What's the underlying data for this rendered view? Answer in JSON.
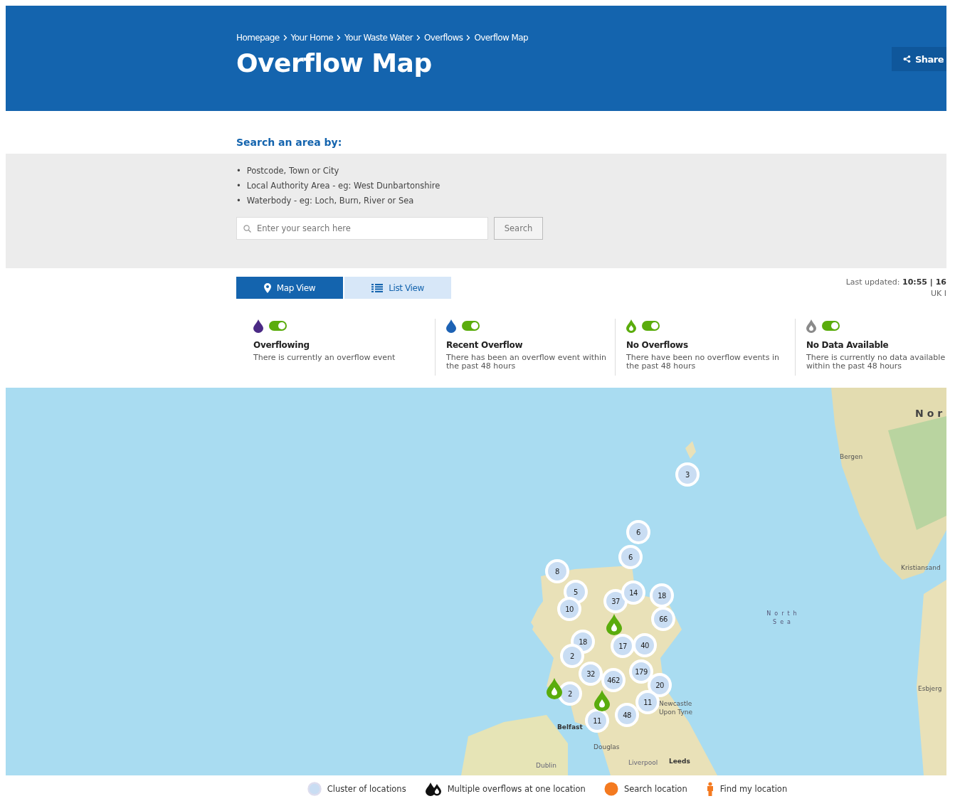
{
  "header": {
    "breadcrumbs": [
      "Homepage",
      "Your Home",
      "Your Waste Water",
      "Overflows",
      "Overflow Map"
    ],
    "title": "Overflow Map",
    "share_button": "Share"
  },
  "search": {
    "heading": "Search an area by:",
    "bullet": "•",
    "options": [
      "Postcode, Town or City",
      "Local Authority Area - eg: West Dunbartonshire",
      "Waterbody - eg: Loch, Burn, River or Sea"
    ],
    "placeholder": "Enter your search here",
    "button": "Search"
  },
  "view_tabs": [
    {
      "label": "Map View",
      "selected": true
    },
    {
      "label": "List View",
      "selected": false
    }
  ],
  "last_updated": {
    "text": "Last updated: **10:55 | 16**",
    "line_2": "UK I"
  },
  "legend": [
    {
      "title": "Overflowing",
      "description": "There is currently an overflow event",
      "color": "#4b2a85",
      "kind": "filled",
      "on": true
    },
    {
      "title": "Recent Overflow",
      "description": "There has been an overflow event within the past 48 hours",
      "color": "#1d62b4",
      "kind": "filled",
      "on": true
    },
    {
      "title": "No Overflows",
      "description": "There have been no overflow events in the past 48 hours",
      "color": "#5aac0c",
      "kind": "outline",
      "on": true
    },
    {
      "title": "No Data Available",
      "description": "There is currently no data available within the past 48 hours",
      "color": "#8a8a8a",
      "kind": "outline",
      "on": true
    }
  ],
  "map": {
    "labels": [
      "Nor",
      "Bergen",
      "Kristiansand",
      "North Sea",
      "Esbjerg",
      "Newcastle Upon Tyne",
      "Belfast",
      "Douglas",
      "Leeds",
      "Dublin",
      "Liverpool"
    ],
    "markers": [
      {
        "kind": "cluster",
        "count": "3"
      },
      {
        "kind": "cluster",
        "count": "6"
      },
      {
        "kind": "cluster",
        "count": "6"
      },
      {
        "kind": "cluster",
        "count": "8"
      },
      {
        "kind": "cluster",
        "count": "5"
      },
      {
        "kind": "cluster",
        "count": "10"
      },
      {
        "kind": "cluster",
        "count": "37"
      },
      {
        "kind": "cluster",
        "count": "14"
      },
      {
        "kind": "cluster",
        "count": "18"
      },
      {
        "kind": "cluster",
        "count": "66"
      },
      {
        "kind": "cluster",
        "count": "18"
      },
      {
        "kind": "cluster",
        "count": "17"
      },
      {
        "kind": "cluster",
        "count": "40"
      },
      {
        "kind": "cluster",
        "count": "2"
      },
      {
        "kind": "cluster",
        "count": "32"
      },
      {
        "kind": "cluster",
        "count": "462"
      },
      {
        "kind": "cluster",
        "count": "179"
      },
      {
        "kind": "cluster",
        "count": "20"
      },
      {
        "kind": "cluster",
        "count": "2"
      },
      {
        "kind": "cluster",
        "count": "11"
      },
      {
        "kind": "cluster",
        "count": "48"
      },
      {
        "kind": "cluster",
        "count": "11"
      },
      {
        "kind": "pin"
      },
      {
        "kind": "pin"
      },
      {
        "kind": "pin"
      }
    ]
  },
  "map_key": [
    {
      "kind": "cluster",
      "label": "Cluster of locations"
    },
    {
      "kind": "multiple",
      "label": "Multiple overflows at one location"
    },
    {
      "kind": "search",
      "label": "Search location"
    },
    {
      "kind": "person",
      "label": "Find my location"
    }
  ]
}
